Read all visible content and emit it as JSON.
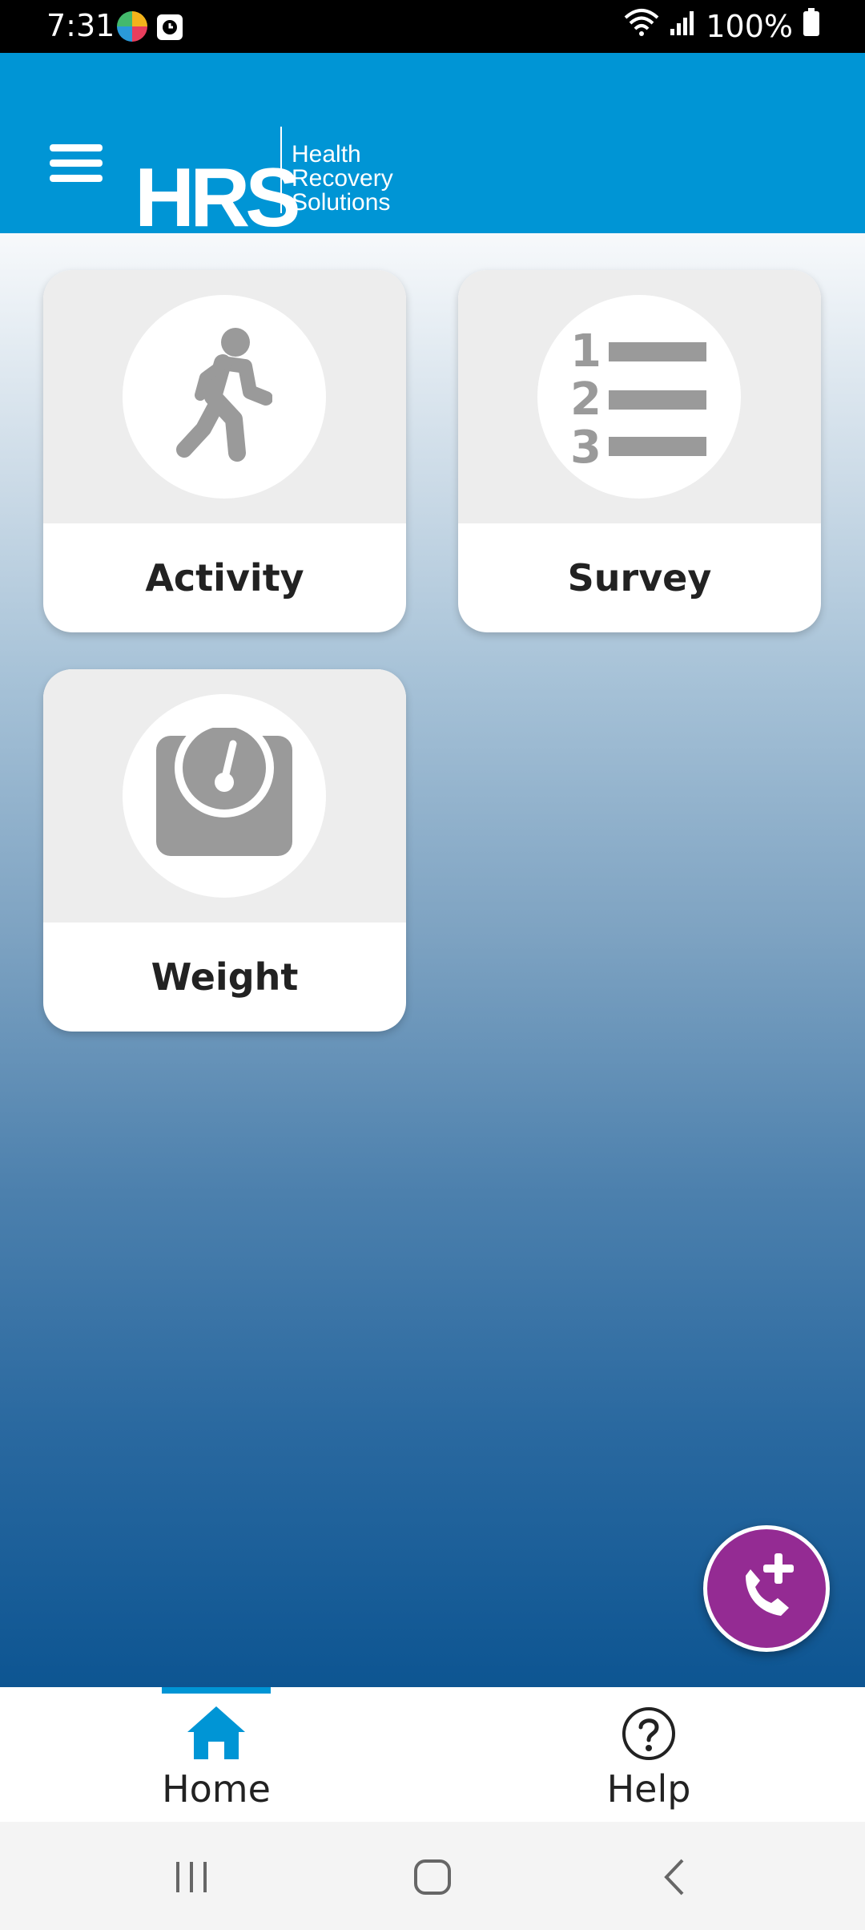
{
  "status_bar": {
    "time": "7:31",
    "battery": "100%"
  },
  "header": {
    "logo_letters": "HRS",
    "logo_line1": "Health",
    "logo_line2": "Recovery",
    "logo_line3": "Solutions",
    "brand_color": "#0095d5"
  },
  "tiles": [
    {
      "label": "Activity",
      "icon": "walking-person-icon"
    },
    {
      "label": "Survey",
      "icon": "numbered-list-icon"
    },
    {
      "label": "Weight",
      "icon": "scale-icon"
    }
  ],
  "fab": {
    "icon": "phone-plus-icon",
    "color": "#942b93"
  },
  "bottom_nav": {
    "items": [
      {
        "label": "Home",
        "icon": "home-icon",
        "active": true
      },
      {
        "label": "Help",
        "icon": "help-icon",
        "active": false
      }
    ]
  }
}
